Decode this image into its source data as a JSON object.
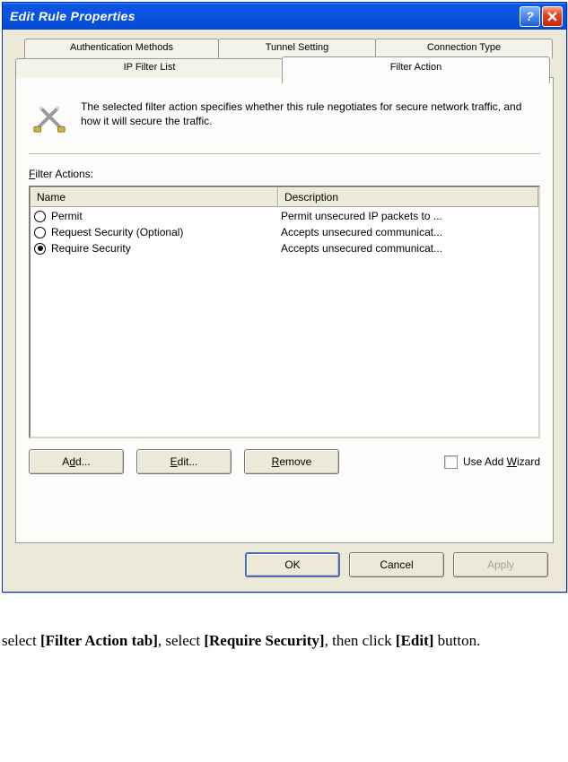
{
  "dialog": {
    "title": "Edit Rule Properties",
    "tabs": {
      "top": [
        "Authentication Methods",
        "Tunnel Setting",
        "Connection Type"
      ],
      "bottom": [
        "IP Filter List",
        "Filter Action"
      ],
      "active": "Filter Action"
    },
    "description": "The selected filter action specifies whether this rule negotiates for secure network traffic, and how it will secure the traffic.",
    "section_label_prefix": "F",
    "section_label_rest": "ilter Actions:",
    "columns": {
      "name": "Name",
      "description": "Description"
    },
    "filter_actions": [
      {
        "name": "Permit",
        "description": "Permit unsecured IP packets to ...",
        "selected": false
      },
      {
        "name": "Request Security (Optional)",
        "description": "Accepts unsecured communicat...",
        "selected": false
      },
      {
        "name": "Require Security",
        "description": "Accepts unsecured communicat...",
        "selected": true
      }
    ],
    "buttons": {
      "add": "Add...",
      "add_u": "d",
      "edit": "Edit...",
      "edit_u": "E",
      "remove": "Remove",
      "remove_u": "R",
      "use_wizard": "Use Add Wizard",
      "use_wizard_u": "W",
      "ok": "OK",
      "cancel": "Cancel",
      "apply": "Apply",
      "wizard_checked": false
    }
  },
  "instruction": {
    "p1a": "select ",
    "p1b": "[Filter Action tab]",
    "p1c": ", select ",
    "p1d": "[Require Security]",
    "p1e": ", then click ",
    "p1f": "[Edit]",
    "p1g": " button."
  }
}
